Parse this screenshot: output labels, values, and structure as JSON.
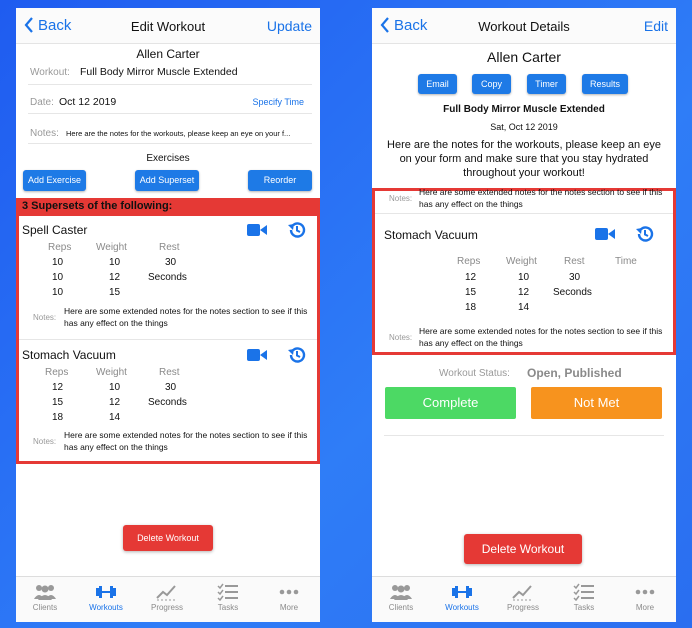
{
  "left": {
    "nav": {
      "back": "Back",
      "title": "Edit Workout",
      "action": "Update"
    },
    "client_name": "Allen Carter",
    "workout_label": "Workout:",
    "workout_value": "Full Body Mirror Muscle Extended",
    "date_label": "Date:",
    "date_value": "Oct 12 2019",
    "specify_time": "Specify Time",
    "notes_label": "Notes:",
    "notes_value": "Here are the notes for the workouts, please keep an eye on your f...",
    "exercises_heading": "Exercises",
    "buttons": {
      "add_exercise": "Add Exercise",
      "add_superset": "Add Superset",
      "reorder": "Reorder"
    },
    "superset_header": "3 Supersets of the following:",
    "exercises": [
      {
        "name": "Spell Caster",
        "reps_h": "Reps",
        "weight_h": "Weight",
        "rest_h": "Rest",
        "reps": [
          "10",
          "10",
          "10"
        ],
        "weights": [
          "10",
          "12",
          "15"
        ],
        "rest": "30",
        "rest_unit": "Seconds",
        "notes_label": "Notes:",
        "notes": "Here are some extended notes for the notes section to see if this has any effect on the things"
      },
      {
        "name": "Stomach Vacuum",
        "reps_h": "Reps",
        "weight_h": "Weight",
        "rest_h": "Rest",
        "reps": [
          "12",
          "15",
          "18"
        ],
        "weights": [
          "10",
          "12",
          "14"
        ],
        "rest": "30",
        "rest_unit": "Seconds",
        "notes_label": "Notes:",
        "notes": "Here are some extended notes for the notes section to see if this has any effect on the things"
      }
    ],
    "delete": "Delete Workout"
  },
  "right": {
    "nav": {
      "back": "Back",
      "title": "Workout Details",
      "action": "Edit"
    },
    "client_name": "Allen Carter",
    "buttons": {
      "email": "Email",
      "copy": "Copy",
      "timer": "Timer",
      "results": "Results"
    },
    "workout_name": "Full Body Mirror Muscle Extended",
    "date": "Sat, Oct 12 2019",
    "notes": "Here are the notes for the workouts, please keep an eye on your form and make sure that you stay hydrated throughout your workout!",
    "prev_notes_label": "Notes:",
    "prev_notes": "Here are some extended notes for the notes section to see if this has any effect on the things",
    "exercise": {
      "name": "Stomach Vacuum",
      "reps_h": "Reps",
      "weight_h": "Weight",
      "rest_h": "Rest",
      "time_h": "Time",
      "reps": [
        "12",
        "15",
        "18"
      ],
      "weights": [
        "10",
        "12",
        "14"
      ],
      "rest": "30",
      "rest_unit": "Seconds",
      "notes_label": "Notes:",
      "notes": "Here are some extended notes for the notes section to see if this has any effect on the things"
    },
    "status_label": "Workout Status:",
    "status_value": "Open, Published",
    "complete": "Complete",
    "not_met": "Not Met",
    "delete": "Delete Workout"
  },
  "tabs": [
    {
      "label": "Clients",
      "icon": "clients-icon"
    },
    {
      "label": "Workouts",
      "icon": "dumbbell-icon"
    },
    {
      "label": "Progress",
      "icon": "progress-chart-icon"
    },
    {
      "label": "Tasks",
      "icon": "tasks-list-icon"
    },
    {
      "label": "More",
      "icon": "more-dots-icon"
    }
  ],
  "colors": {
    "accent": "#1e7ae6",
    "danger": "#e53935",
    "success": "#4cd964",
    "warning": "#f7931e",
    "background": "#2a6ef0"
  }
}
